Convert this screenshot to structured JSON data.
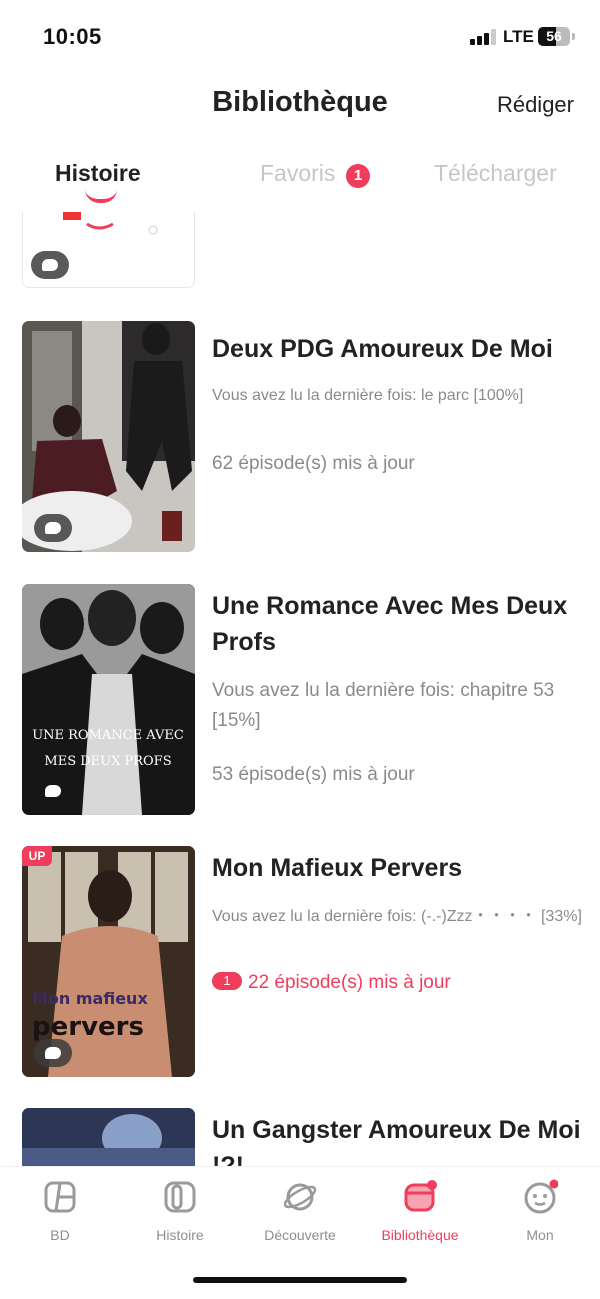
{
  "status_bar": {
    "time": "10:05",
    "network": "LTE",
    "battery": "56",
    "battery_level": 0.56
  },
  "header": {
    "title": "Bibliothèque",
    "compose": "Rédiger"
  },
  "tabs": [
    {
      "label": "Histoire",
      "active": true
    },
    {
      "label": "Favoris",
      "badge": "1"
    },
    {
      "label": "Télécharger"
    }
  ],
  "items": [
    {
      "title": "Deux PDG Amoureux De Moi",
      "progress": "Vous avez lu la dernière fois: le parc [100%]",
      "updates": "62 épisode(s) mis à jour"
    },
    {
      "title": "Une Romance Avec Mes Deux Profs",
      "progress": "Vous avez lu la dernière fois: chapitre 53 [15%]",
      "updates": "53 épisode(s) mis à jour",
      "cover_text": "UNE ROMANCE AVEC MES DEUX PROFS"
    },
    {
      "title": "Mon Mafieux Pervers",
      "progress": "Vous avez lu la dernière fois: (-.-)Zzz・・・・ [33%]",
      "updates": "22 épisode(s) mis à jour",
      "new_count": "1",
      "up_badge": "UP",
      "cover_text_1": "Mon mafieux",
      "cover_text_2": "pervers"
    },
    {
      "title": "Un Gangster Amoureux De Moi !?!"
    }
  ],
  "bottom_nav": [
    {
      "label": "BD",
      "icon": "comic-book-icon"
    },
    {
      "label": "Histoire",
      "icon": "book-icon"
    },
    {
      "label": "Découverte",
      "icon": "planet-icon"
    },
    {
      "label": "Bibliothèque",
      "icon": "library-icon",
      "active": true
    },
    {
      "label": "Mon",
      "icon": "profile-face-icon"
    }
  ],
  "colors": {
    "accent": "#f13d5c",
    "text": "#222222",
    "muted": "#8a8a8a"
  }
}
